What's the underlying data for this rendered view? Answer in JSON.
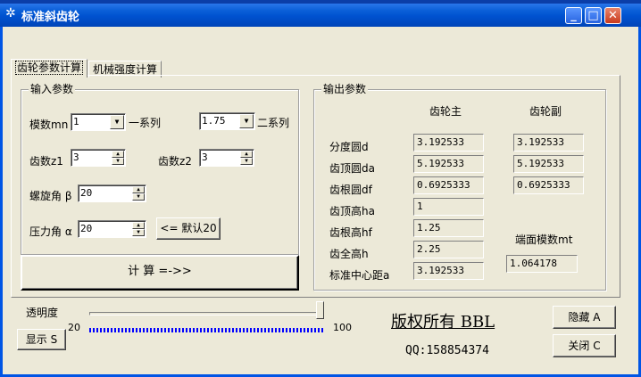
{
  "window": {
    "title": "标准斜齿轮",
    "minimize_glyph": "_",
    "maximize_glyph": "□",
    "close_glyph": "✕"
  },
  "tabs": [
    {
      "label": "齿轮参数计算",
      "active": true
    },
    {
      "label": "机械强度计算",
      "active": false
    }
  ],
  "input": {
    "title": "输入参数",
    "module_label": "模数mn",
    "module_value": "1",
    "series1_label": "一系列",
    "series2_value": "1.75",
    "series2_label": "二系列",
    "z1_label": "齿数z1",
    "z1_value": "3",
    "z2_label": "齿数z2",
    "z2_value": "3",
    "helix_label": "螺旋角 β",
    "helix_value": "20",
    "pressure_label": "压力角 α",
    "pressure_value": "20",
    "default_button": "<= 默认20",
    "calc_button": "计 算 =->>"
  },
  "output": {
    "title": "输出参数",
    "col_main": "齿轮主",
    "col_sub": "齿轮副",
    "rows": [
      {
        "label": "分度圆d",
        "main": "3.192533",
        "sub": "3.192533"
      },
      {
        "label": "齿顶圆da",
        "main": "5.192533",
        "sub": "5.192533"
      },
      {
        "label": "齿根圆df",
        "main": "0.6925333",
        "sub": "0.6925333"
      },
      {
        "label": "齿顶高ha",
        "main": "1"
      },
      {
        "label": "齿根高hf",
        "main": "1.25"
      },
      {
        "label": "齿全高h",
        "main": "2.25"
      },
      {
        "label": "标准中心距a",
        "main": "3.192533"
      }
    ],
    "mt_label": "端面模数mt",
    "mt_value": "1.064178"
  },
  "bottom": {
    "transparency_label": "透明度",
    "slider_min": "20",
    "slider_max": "100",
    "slider_level": 1.0,
    "show_button": "显示 S",
    "copyright": "版权所有 BBL",
    "qq": "QQ:158854374",
    "hide_button": "隐藏 A",
    "close_button": "关闭 C"
  },
  "colors": {
    "titlebar": "#0a5fd8",
    "face": "#ece9d8",
    "ticks": "#0000ff"
  }
}
